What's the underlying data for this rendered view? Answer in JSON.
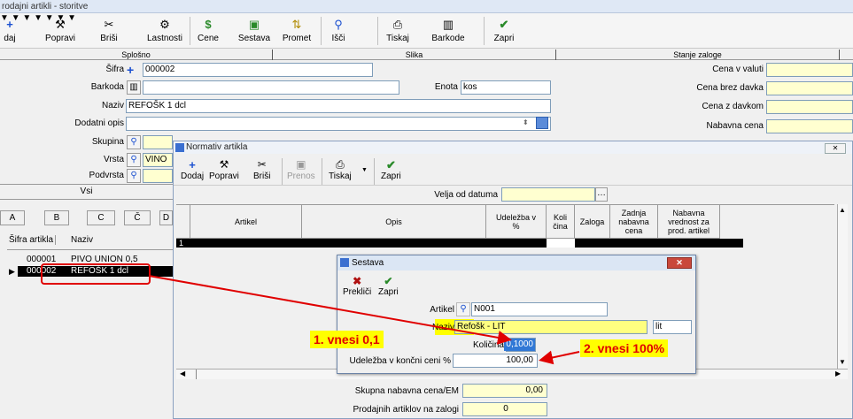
{
  "window": {
    "title": "rodajni artikli - storitve"
  },
  "toolbar": [
    {
      "icon": "plus-icon",
      "glyph": "+",
      "label": "daj"
    },
    {
      "icon": "hammer-icon",
      "glyph": "⚒",
      "label": "Popravi"
    },
    {
      "icon": "scissors-icon",
      "glyph": "✂",
      "label": "Briši"
    },
    {
      "icon": "properties-icon",
      "glyph": "⚙",
      "label": "Lastnosti"
    },
    {
      "icon": "price-icon",
      "glyph": "$",
      "label": "Cene"
    },
    {
      "icon": "composition-icon",
      "glyph": "▣",
      "label": "Sestava"
    },
    {
      "icon": "traffic-icon",
      "glyph": "⇅",
      "label": "Promet"
    },
    {
      "icon": "search-icon",
      "glyph": "⚲",
      "label": "Išči"
    },
    {
      "icon": "print-icon",
      "glyph": "⎙",
      "label": "Tiskaj"
    },
    {
      "icon": "barcode-icon",
      "glyph": "▥",
      "label": "Barkode"
    },
    {
      "icon": "check-icon",
      "glyph": "✔",
      "label": "Zapri"
    }
  ],
  "tabs": [
    "Splošno",
    "Slika",
    "Stanje zaloge"
  ],
  "form": {
    "sifra_label": "Šifra",
    "sifra_value": "000002",
    "barkoda_label": "Barkoda",
    "enota_label": "Enota",
    "enota_value": "kos",
    "naziv_label": "Naziv",
    "naziv_value": "REFOŠK 1 dcl",
    "dodatni_label": "Dodatni opis",
    "skupina_label": "Skupina",
    "vrsta_label": "Vrsta",
    "vrsta_value": "VINO",
    "podvrsta_label": "Podvrsta"
  },
  "right_form": {
    "cena_valuti": "Cena v valuti",
    "cena_brez": "Cena brez davka",
    "cena_z": "Cena z davkom",
    "nabavna": "Nabavna cena"
  },
  "left_panel": {
    "filter_label": "Vsi",
    "columns": [
      "A",
      "B",
      "C",
      "Č",
      "D"
    ],
    "head_sifra": "Šifra artikla",
    "head_naziv": "Naziv",
    "rows": [
      {
        "sifra": "000001",
        "naziv": "PIVO UNION 0,5"
      },
      {
        "sifra": "000002",
        "naziv": "REFOŠK 1 dcl"
      }
    ]
  },
  "normativ": {
    "title": "Normativ artikla",
    "toolbar": [
      {
        "glyph": "+",
        "icon": "plus-icon",
        "label": "Dodaj"
      },
      {
        "glyph": "⚒",
        "icon": "hammer-icon",
        "label": "Popravi"
      },
      {
        "glyph": "✂",
        "icon": "scissors-icon",
        "label": "Briši"
      },
      {
        "glyph": "▣",
        "icon": "transfer-icon",
        "label": "Prenos"
      },
      {
        "glyph": "⎙",
        "icon": "print-icon",
        "label": "Tiskaj"
      },
      {
        "glyph": "✔",
        "icon": "check-icon",
        "label": "Zapri"
      }
    ],
    "velja_label": "Velja od datuma",
    "columns": [
      "Artikel",
      "Opis",
      "Udeležba v %",
      "Koli čina",
      "Zaloga",
      "Zadnja nabavna cena",
      "Nabavna vrednost za prod. artikel"
    ],
    "row_number": "1",
    "skupna_label": "Skupna nabavna cena/EM",
    "skupna_value": "0,00",
    "prodajnih_label": "Prodajnih artiklov na zalogi",
    "prodajnih_value": "0"
  },
  "sestava": {
    "title": "Sestava",
    "preklici": "Prekliči",
    "zapri": "Zapri",
    "artikel_label": "Artikel",
    "artikel_value": "N001",
    "naziv_label": "Naziv",
    "naziv_value": "Refošk - LIT",
    "enota_value": "lit",
    "kolicina_label": "Količina",
    "kolicina_value": "0,1000",
    "udelezba_label": "Udeležba v končni ceni %",
    "udelezba_value": "100,00"
  },
  "annotations": {
    "step1": "1. vnesi 0,1",
    "step2": "2. vnesi 100%"
  },
  "colors": {
    "highlight_red": "#e00000",
    "callout_yellow": "#ffff00",
    "field_yellow": "#ffffd0"
  }
}
